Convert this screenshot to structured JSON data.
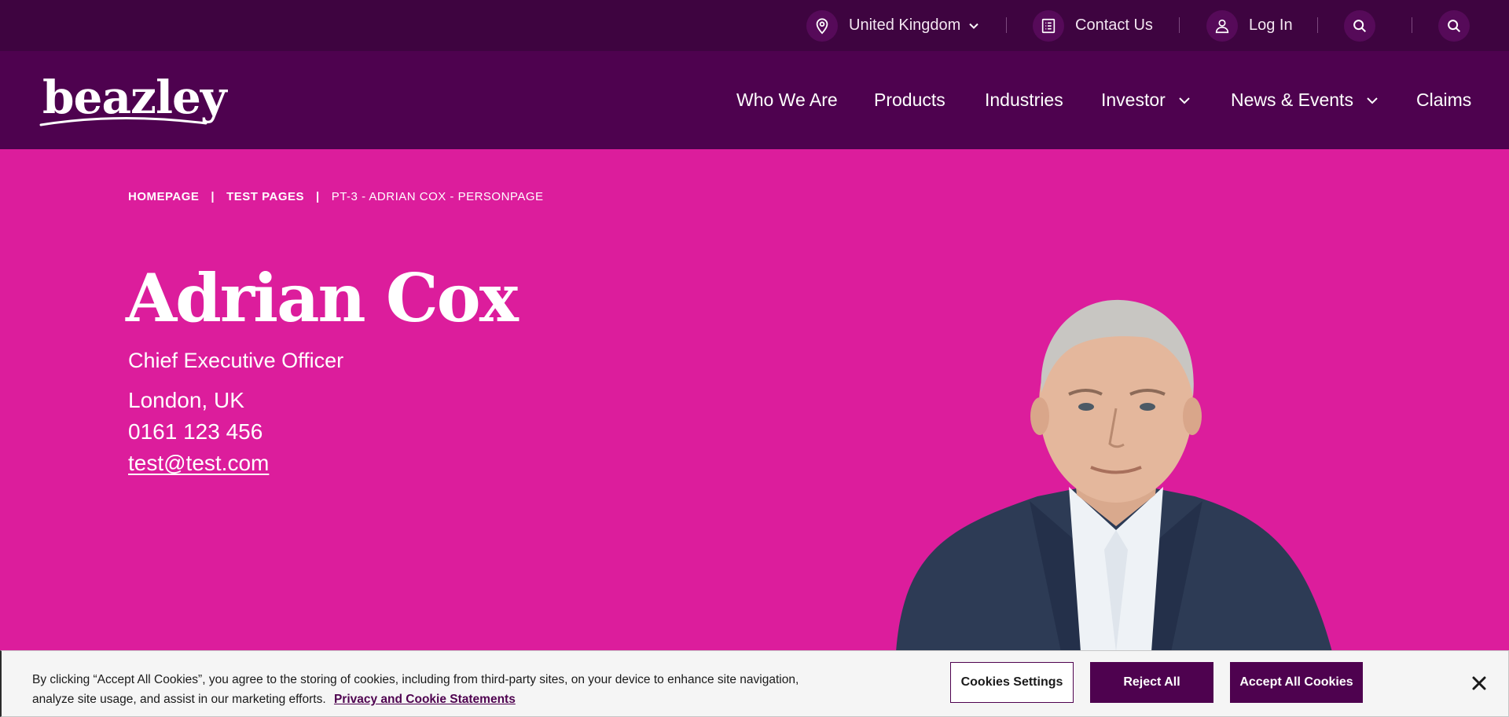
{
  "topbar": {
    "region_label": "United Kingdom",
    "contact_label": "Contact Us",
    "login_label": "Log In",
    "icons": [
      "location-pin-icon",
      "chevron-down-icon",
      "document-list-icon",
      "user-icon",
      "search-icon"
    ]
  },
  "brand": {
    "logo_text": "beazley"
  },
  "nav": {
    "items": [
      {
        "label": "Who We Are"
      },
      {
        "label": "Products"
      },
      {
        "label": "Industries"
      },
      {
        "label": "Investor"
      },
      {
        "label": "News & Events"
      },
      {
        "label": "Claims"
      }
    ]
  },
  "breadcrumb": {
    "home": "HOMEPAGE",
    "separator": "|",
    "section": "TEST PAGES",
    "current": "PT-3 - ADRIAN COX - PERSONPAGE"
  },
  "profile": {
    "name": "Adrian Cox",
    "role": "Chief Executive Officer",
    "location": "London, UK",
    "phone": "0161 123 456",
    "email": "test@test.com"
  },
  "cookie": {
    "text": "By clicking “Accept All Cookies”, you agree to the storing of cookies, including from third-party sites, on your device to enhance site navigation, analyze site usage, and assist in our marketing efforts.",
    "link": "Privacy and Cookie Statements",
    "settings_label": "Cookies Settings",
    "reject_label": "Reject All",
    "accept_label": "Accept All Cookies"
  },
  "colors": {
    "topbar": "#3e0440",
    "nav": "#4e024f",
    "hero": "#dc1d9c",
    "banner": "#f5f5f5"
  }
}
